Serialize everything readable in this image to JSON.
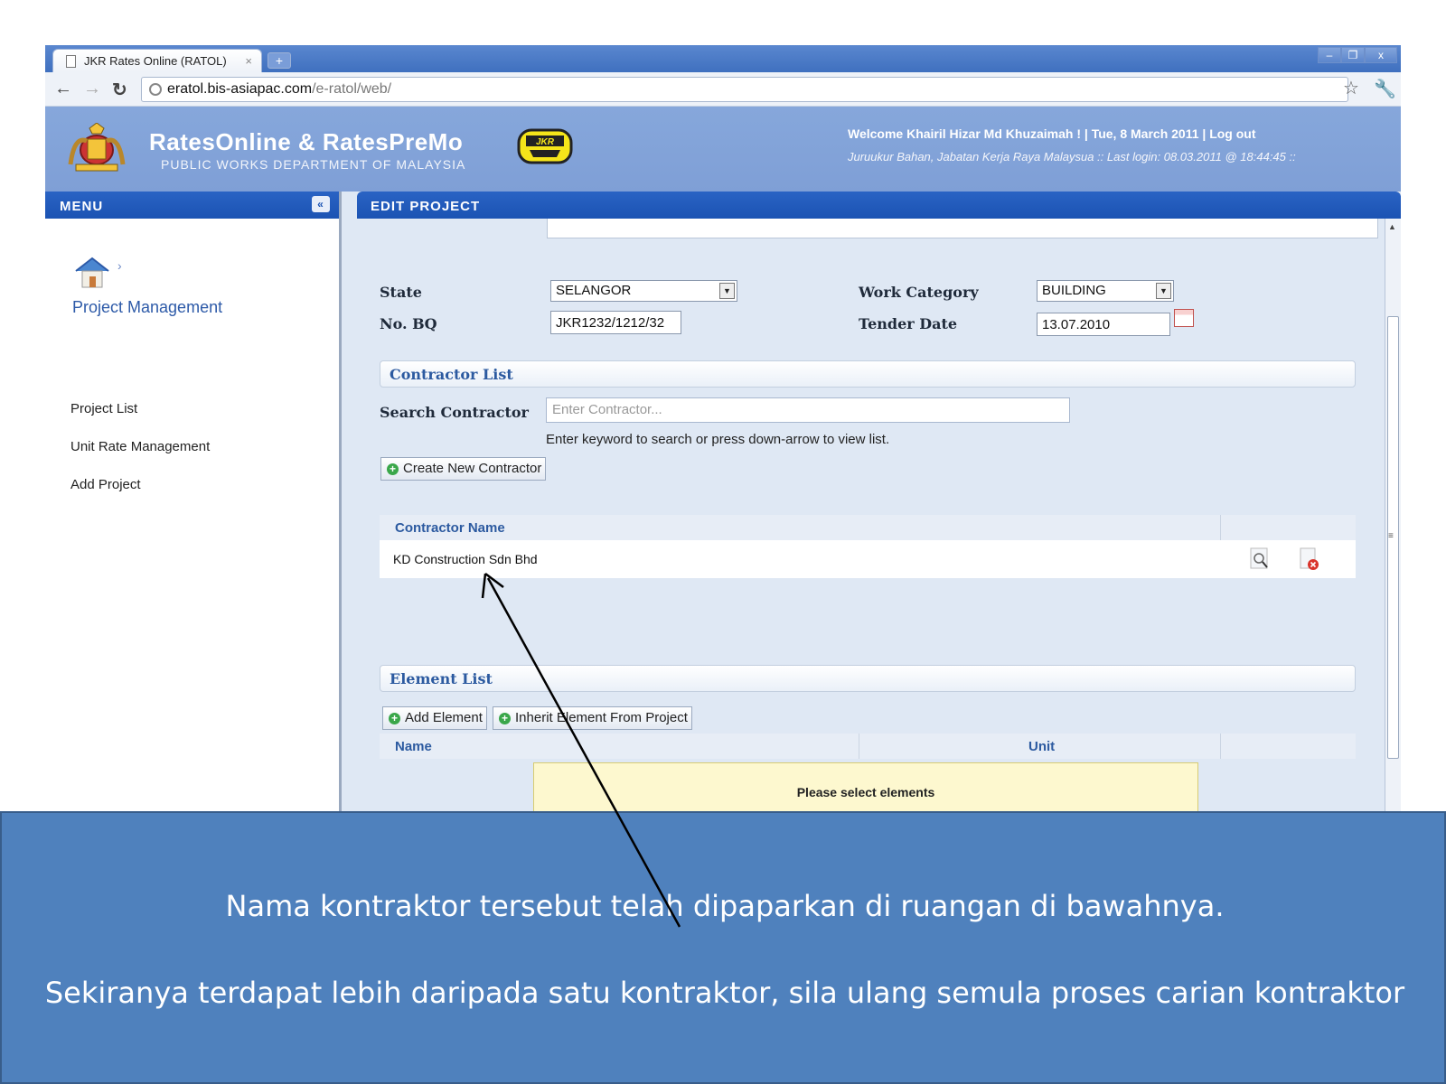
{
  "browser": {
    "tab_title": "JKR Rates Online (RATOL)",
    "tab_close": "×",
    "new_tab": "+",
    "url_host": "eratol.bis-asiapac.com",
    "url_path": "/e-ratol/web/"
  },
  "header": {
    "title": "RatesOnline & RatesPreMo",
    "subtitle": "PUBLIC WORKS DEPARTMENT OF MALAYSIA",
    "logo_text": "JKR",
    "welcome": "Welcome Khairil Hizar Md Khuzaimah ! | Tue, 8 March 2011 | Log out",
    "last_login": "Juruukur Bahan, Jabatan Kerja Raya Malaysua :: Last login: 08.03.2011 @ 18:44:45 ::"
  },
  "sidebar": {
    "heading": "MENU",
    "collapse": "«",
    "crumb_sep": "›",
    "section_title": "Project Management",
    "items": [
      {
        "label": "Project List"
      },
      {
        "label": "Unit Rate Management"
      },
      {
        "label": "Add Project"
      }
    ]
  },
  "content": {
    "heading": "EDIT PROJECT",
    "state_label": "State",
    "state_value": "SELANGOR",
    "work_category_label": "Work Category",
    "work_category_value": "BUILDING",
    "bq_label": "No. BQ",
    "bq_value": "JKR1232/1212/32",
    "tender_date_label": "Tender Date",
    "tender_date_value": "13.07.2010",
    "contractor_section": "Contractor List",
    "search_contractor_label": "Search Contractor",
    "search_contractor_placeholder": "Enter Contractor...",
    "search_hint": "Enter keyword to search or press down-arrow to view list.",
    "create_contractor_button": "Create New Contractor",
    "contractor_table_header": "Contractor Name",
    "contractors": [
      {
        "name": "KD Construction Sdn Bhd"
      }
    ],
    "element_section": "Element List",
    "add_element_button": "Add Element",
    "inherit_element_button": "Inherit Element From Project",
    "element_table": {
      "name_header": "Name",
      "unit_header": "Unit"
    },
    "empty_message": "Please select elements"
  },
  "caption": {
    "line1": "Nama kontraktor tersebut telah dipaparkan di ruangan di bawahnya.",
    "line2": "Sekiranya terdapat lebih daripada satu kontraktor, sila ulang semula proses carian kontraktor"
  },
  "colors": {
    "caption_bg": "#4f81bd",
    "header_bar": "#1b53b3",
    "app_header": "#86a7db",
    "panel_bg": "#dfe8f4"
  }
}
